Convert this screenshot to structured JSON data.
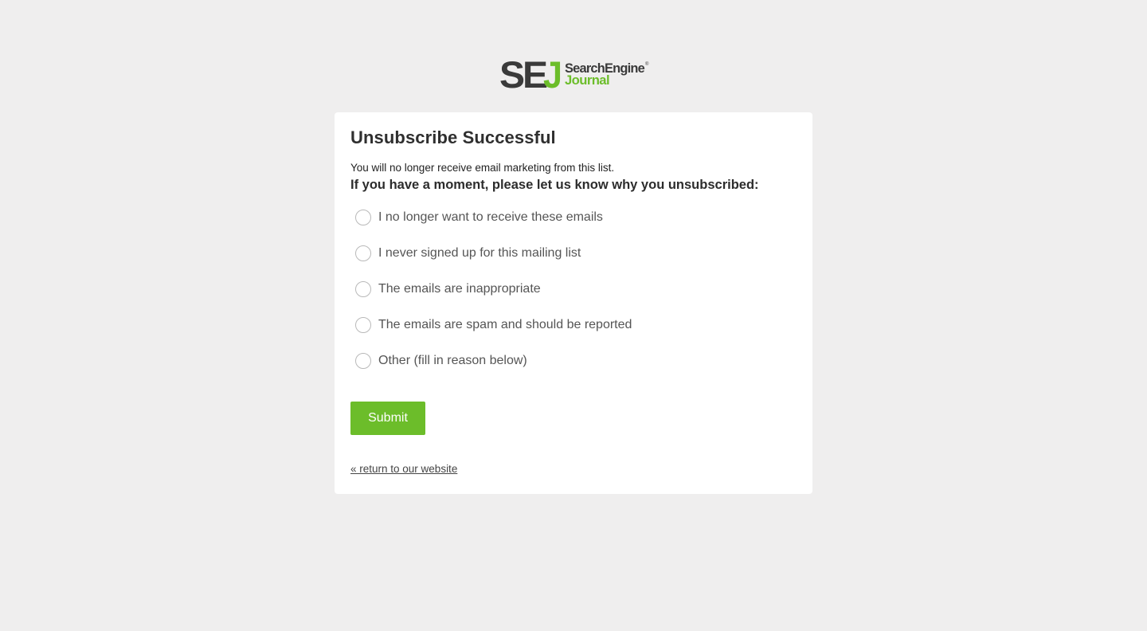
{
  "brand": {
    "logo_mark": "SEJ",
    "logo_line1": "SearchEngine",
    "logo_line2": "Journal",
    "registered_mark": "®",
    "colors": {
      "dark": "#3a3a3a",
      "green": "#6cbd2a"
    }
  },
  "card": {
    "title": "Unsubscribe Successful",
    "notice": "You will no longer receive email marketing from this list.",
    "prompt": "If you have a moment, please let us know why you unsubscribed:"
  },
  "reasons": [
    {
      "label": "I no longer want to receive these emails",
      "selected": false
    },
    {
      "label": "I never signed up for this mailing list",
      "selected": false
    },
    {
      "label": "The emails are inappropriate",
      "selected": false
    },
    {
      "label": "The emails are spam and should be reported",
      "selected": false
    },
    {
      "label": "Other (fill in reason below)",
      "selected": false
    }
  ],
  "actions": {
    "submit_label": "Submit",
    "return_label": "« return to our website"
  },
  "colors": {
    "page_background": "#efeeee",
    "card_background": "#ffffff",
    "accent": "#6cbd2a"
  }
}
